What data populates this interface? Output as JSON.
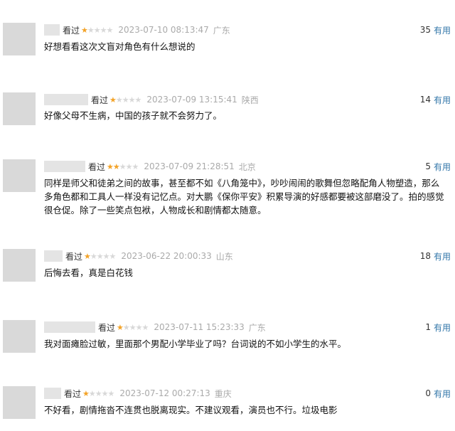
{
  "reviews": [
    {
      "watched_label": "看过",
      "rating": 1,
      "time": "2023-07-10 08:13:47",
      "location": "广东",
      "useful_count": "35",
      "useful_label": "有用",
      "content": "好想看看这次文盲对角色有什么想说的"
    },
    {
      "watched_label": "看过",
      "rating": 1,
      "time": "2023-07-09 13:15:41",
      "location": "陕西",
      "useful_count": "14",
      "useful_label": "有用",
      "content": "好像父母不生病，中国的孩子就不会努力了。"
    },
    {
      "watched_label": "看过",
      "rating": 2,
      "time": "2023-07-09 21:28:51",
      "location": "北京",
      "useful_count": "5",
      "useful_label": "有用",
      "content": "同样是师父和徒弟之间的故事，甚至都不如《八角笼中》，吵吵闹闹的歌舞但忽略配角人物塑造，那么多角色都和工具人一样没有记忆点。对大鹏《保你平安》积累导演的好感都要被这部磨没了。拍的感觉很仓促。除了一些笑点包袱，人物成长和剧情都太随意。"
    },
    {
      "watched_label": "看过",
      "rating": 1,
      "time": "2023-06-22 20:00:33",
      "location": "山东",
      "useful_count": "18",
      "useful_label": "有用",
      "content": "后悔去看，真是白花钱"
    },
    {
      "watched_label": "看过",
      "rating": 1,
      "time": "2023-07-11 15:23:33",
      "location": "广东",
      "useful_count": "1",
      "useful_label": "有用",
      "content": "我对面瘫脸过敏，里面那个男配小学毕业了吗？台词说的不如小学生的水平。"
    },
    {
      "watched_label": "看过",
      "rating": 1,
      "time": "2023-07-12 00:27:13",
      "location": "重庆",
      "useful_count": "0",
      "useful_label": "有用",
      "content": "不好看，剧情拖沓不连贯也脱离现实。不建议观看，演员也不行。垃圾电影"
    }
  ],
  "colors": {
    "star_on": "#f3a328",
    "star_off": "#d8d8d8",
    "useful_link": "#3377aa",
    "meta_gray": "#aaaaaa"
  }
}
